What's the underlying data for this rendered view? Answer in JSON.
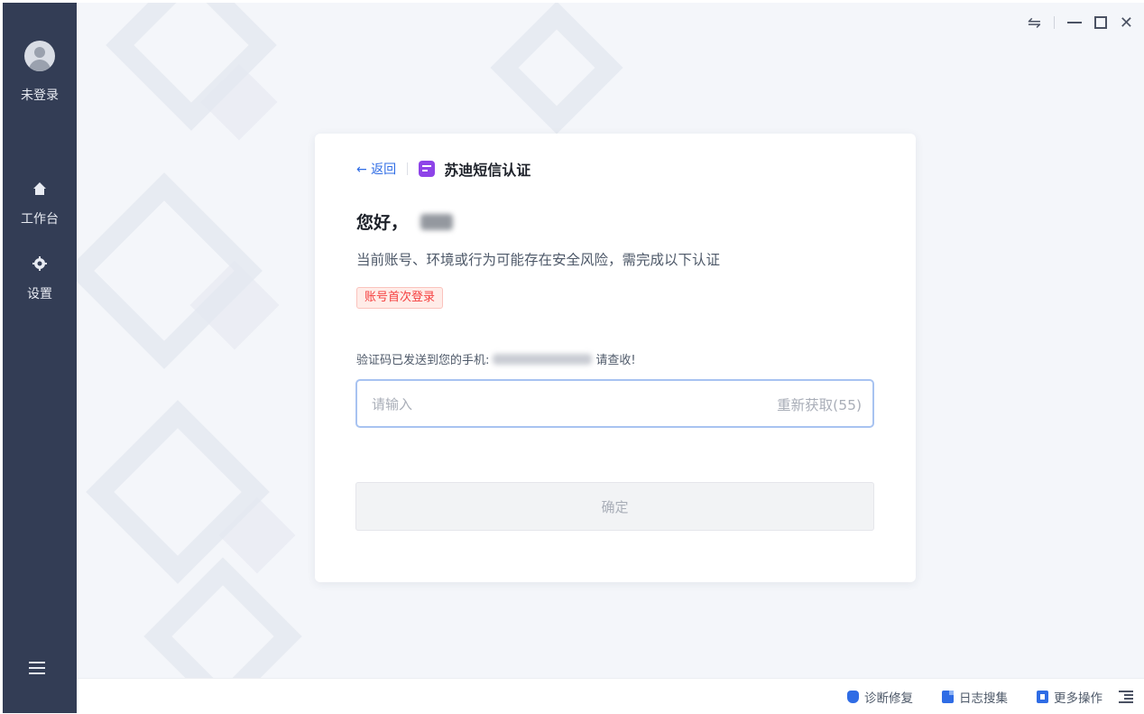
{
  "sidebar": {
    "user_label": "未登录",
    "items": [
      {
        "label": "工作台",
        "icon": "home-icon"
      },
      {
        "label": "设置",
        "icon": "gear-icon"
      }
    ],
    "menu_icon": "menu-icon"
  },
  "window": {
    "controls": [
      "switch-icon",
      "minimize-icon",
      "maximize-icon",
      "close-icon"
    ]
  },
  "card": {
    "back_label": "← 返回",
    "title": "苏迪短信认证",
    "greeting": "您好，",
    "risk_text": "当前账号、环境或行为可能存在安全风险，需完成以下认证",
    "tag": "账号首次登录",
    "sent_prefix": "验证码已发送到您的手机:",
    "sent_suffix": "请查收!",
    "input_placeholder": "请输入",
    "resend_label": "重新获取(55)",
    "confirm_label": "确定"
  },
  "footer": {
    "items": [
      {
        "label": "诊断修复",
        "icon": "shield-icon"
      },
      {
        "label": "日志搜集",
        "icon": "document-icon"
      },
      {
        "label": "更多操作",
        "icon": "more-icon"
      }
    ],
    "collapse_icon": "indent-icon"
  },
  "colors": {
    "sidebar_bg": "#333d55",
    "accent": "#2f6ce5",
    "tag_red": "#f53f3f",
    "sms_purple": "#8e44e8"
  }
}
